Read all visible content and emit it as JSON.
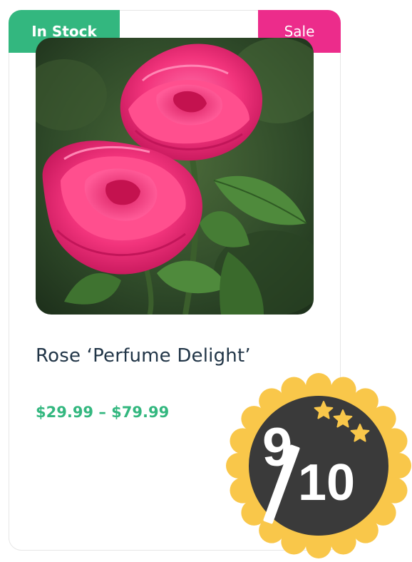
{
  "badges": {
    "stock": "In Stock",
    "sale": "Sale"
  },
  "product": {
    "image_icon": "rose-photo",
    "title": "Rose ‘Perfume Delight’",
    "price": "$29.99 – $79.99"
  },
  "rating": {
    "numerator": "9",
    "denominator": "10",
    "stars": 3,
    "colors": {
      "badge_edge": "#f9c74a",
      "badge_center": "#3a3a3a",
      "star": "#f9c74a"
    }
  },
  "colors": {
    "stock": "#33b77f",
    "sale": "#ec2c8b",
    "title": "#213547",
    "price": "#33b77f"
  }
}
